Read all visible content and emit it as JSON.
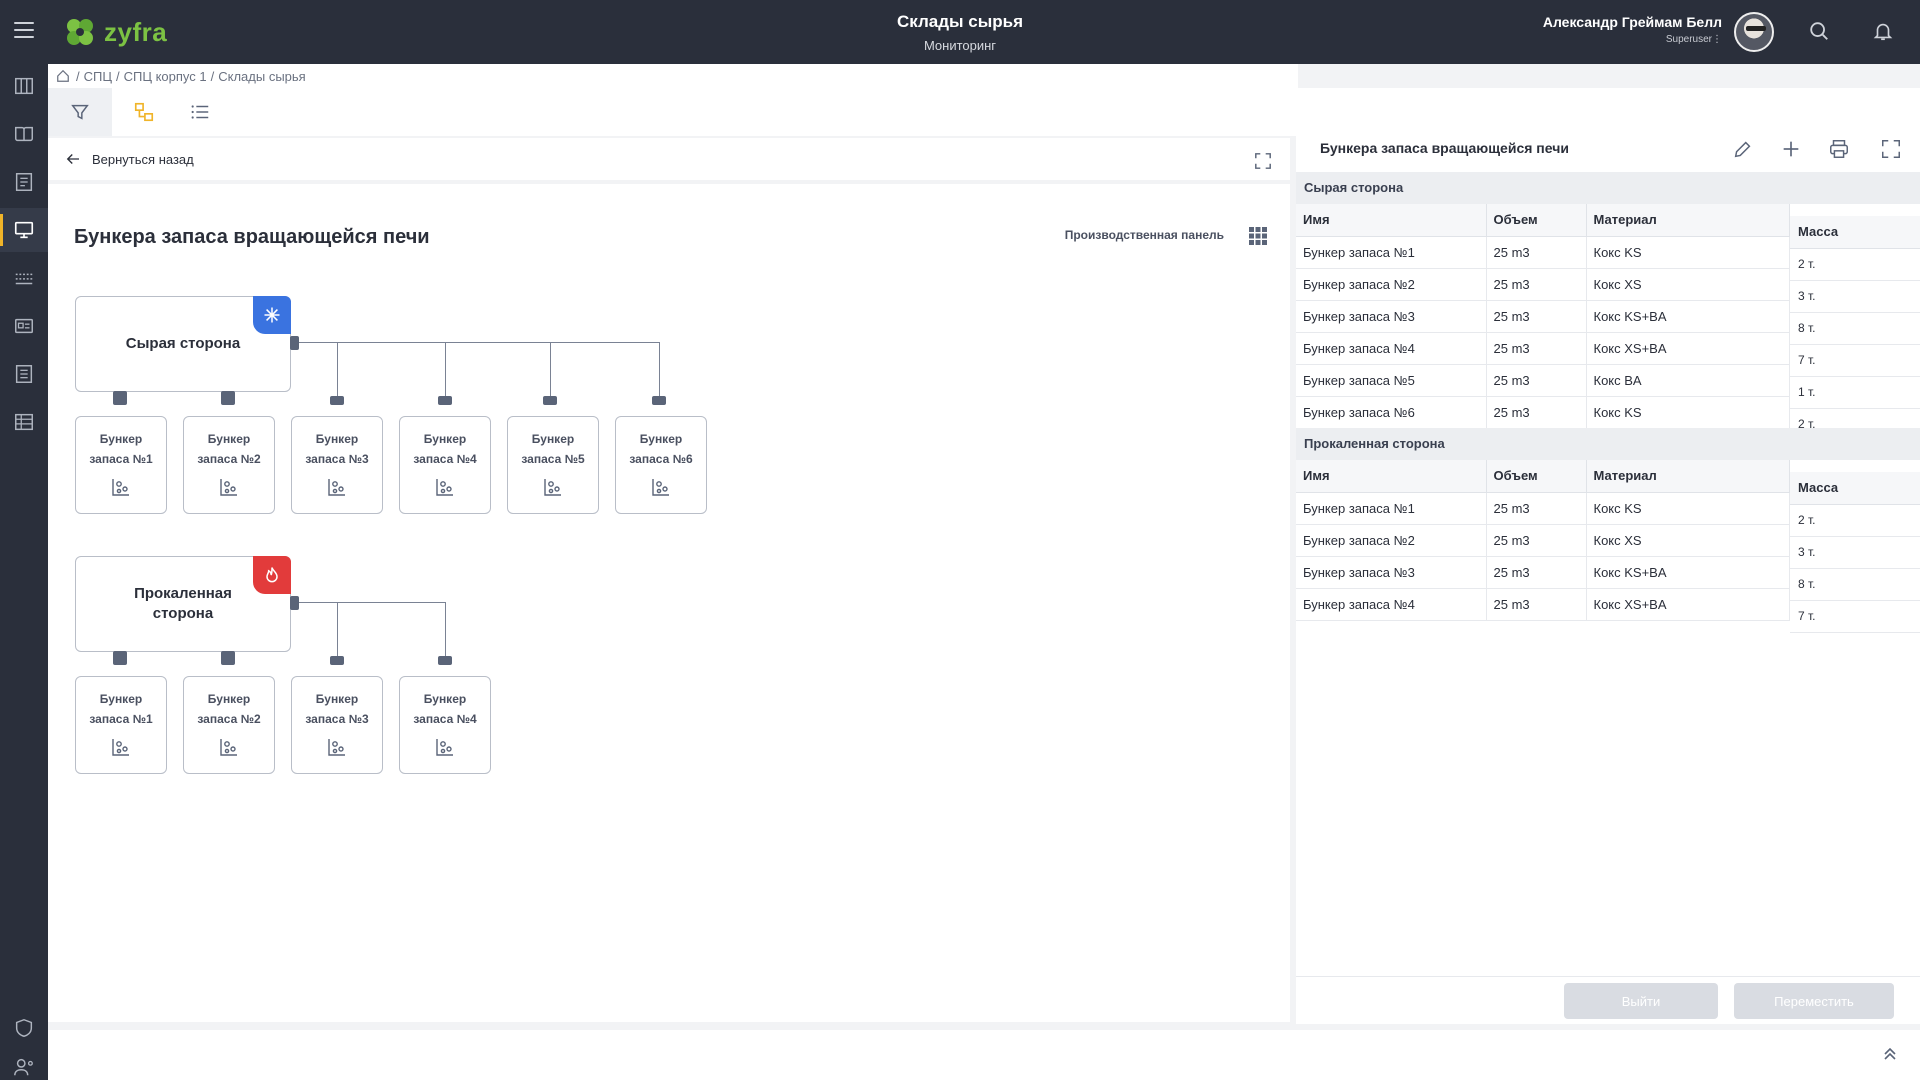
{
  "app": {
    "logo_text": "zyfra",
    "title": "Склады сырья",
    "subtitle": "Мониторинг",
    "user_name": "Александр Греймам Белл",
    "user_role": "Superuser⋮"
  },
  "breadcrumb": [
    "/",
    "СПЦ",
    "/",
    "СПЦ корпус 1",
    "/",
    "Склады сырья"
  ],
  "main": {
    "back_label": "Вернуться назад",
    "title": "Бункера запаса вращающейся печи",
    "prod_panel": "Производственная панель"
  },
  "diagram": {
    "raw": {
      "label": "Сырая сторона",
      "badge_color": "#3a73e0",
      "badge_icon": "snowflake-icon",
      "children": [
        {
          "l1": "Бункер",
          "l2": "запаса №1"
        },
        {
          "l1": "Бункер",
          "l2": "запаса №2"
        },
        {
          "l1": "Бункер",
          "l2": "запаса №3"
        },
        {
          "l1": "Бункер",
          "l2": "запаса №4"
        },
        {
          "l1": "Бункер",
          "l2": "запаса №5"
        },
        {
          "l1": "Бункер",
          "l2": "запаса №6"
        }
      ]
    },
    "calc": {
      "label_1": "Прокаленная",
      "label_2": "сторона",
      "badge_color": "#e23b3b",
      "badge_icon": "flame-icon",
      "children": [
        {
          "l1": "Бункер",
          "l2": "запаса №1"
        },
        {
          "l1": "Бункер",
          "l2": "запаса №2"
        },
        {
          "l1": "Бункер",
          "l2": "запаса №3"
        },
        {
          "l1": "Бункер",
          "l2": "запаса №4"
        }
      ]
    }
  },
  "right": {
    "title": "Бункера запаса вращающейся печи",
    "sections": [
      {
        "name": "Сырая сторона",
        "headers": [
          "Имя",
          "Объем",
          "Материал"
        ],
        "mass_header": "Масса",
        "rows": [
          [
            "Бункер запаса №1",
            "25 m3",
            "Кокс KS"
          ],
          [
            "Бункер запаса №2",
            "25 m3",
            "Кокс XS"
          ],
          [
            "Бункер запаса №3",
            "25 m3",
            "Кокс KS+BA"
          ],
          [
            "Бункер запаса №4",
            "25 m3",
            "Кокс XS+BA"
          ],
          [
            "Бункер запаса №5",
            "25 m3",
            "Кокс BA"
          ],
          [
            "Бункер запаса №6",
            "25 m3",
            "Кокс KS"
          ]
        ],
        "mass": [
          "2 т.",
          "3 т.",
          "8 т.",
          "7 т.",
          "1 т.",
          "2 т."
        ]
      },
      {
        "name": "Прокаленная сторона",
        "headers": [
          "Имя",
          "Объем",
          "Материал"
        ],
        "mass_header": "Масса",
        "rows": [
          [
            "Бункер запаса №1",
            "25 m3",
            "Кокс KS"
          ],
          [
            "Бункер запаса №2",
            "25 m3",
            "Кокс XS"
          ],
          [
            "Бункер запаса №3",
            "25 m3",
            "Кокс KS+BA"
          ],
          [
            "Бункер запаса №4",
            "25 m3",
            "Кокс XS+BA"
          ]
        ],
        "mass": [
          "2 т.",
          "3 т.",
          "8 т.",
          "7 т."
        ]
      }
    ],
    "btn_exit": "Выйти",
    "btn_move": "Переместить"
  },
  "colors": {
    "header_bg": "#2a2f3b",
    "accent_yellow": "#f0b429",
    "logo_green": "#7cc243"
  }
}
